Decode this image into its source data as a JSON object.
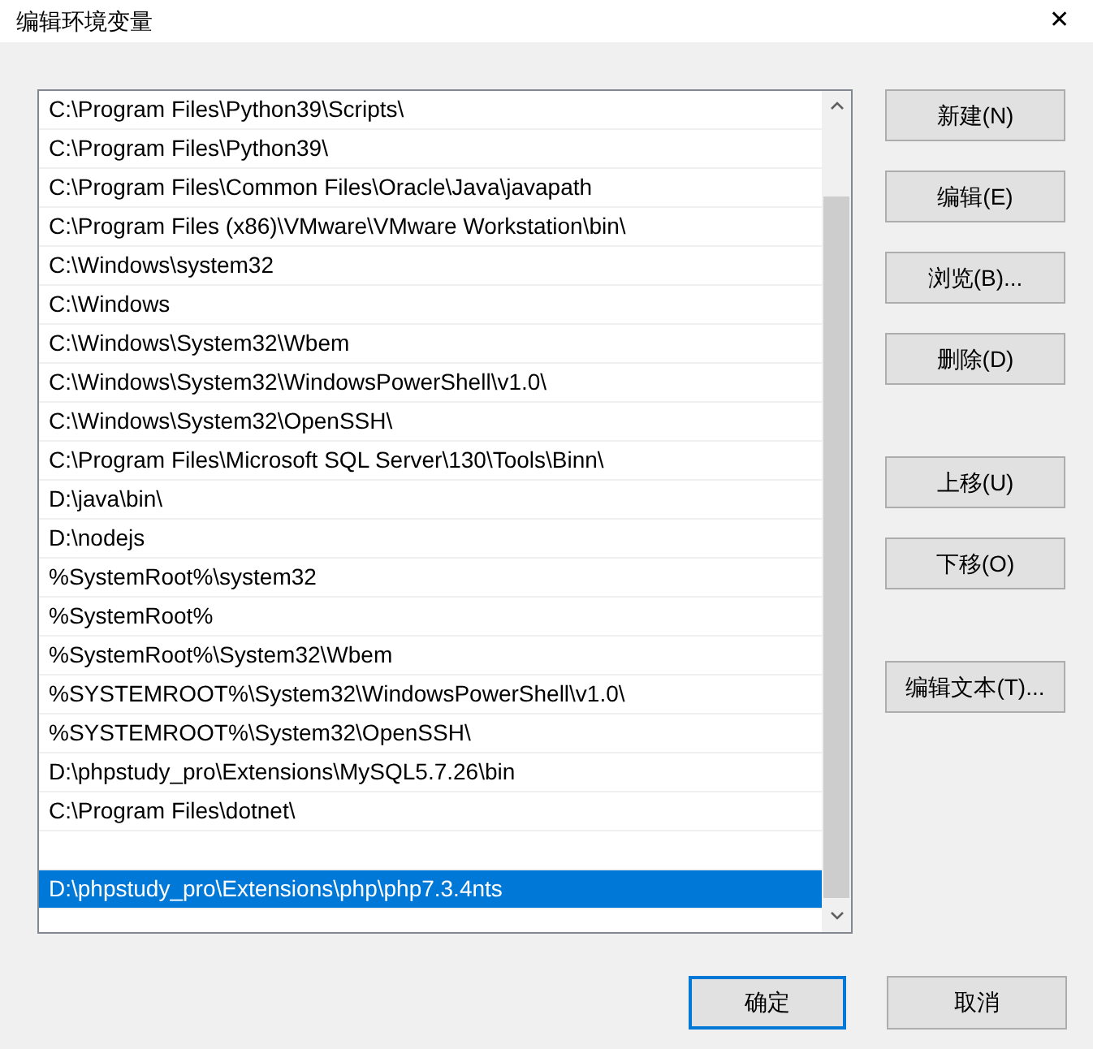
{
  "window": {
    "title": "编辑环境变量",
    "close": "✕"
  },
  "paths": [
    {
      "kind": "text",
      "label": "C:\\Program Files\\Python39\\Scripts\\",
      "selected": false
    },
    {
      "kind": "text",
      "label": "C:\\Program Files\\Python39\\",
      "selected": false
    },
    {
      "kind": "text",
      "label": "C:\\Program Files\\Common Files\\Oracle\\Java\\javapath",
      "selected": false
    },
    {
      "kind": "text",
      "label": "C:\\Program Files (x86)\\VMware\\VMware Workstation\\bin\\",
      "selected": false
    },
    {
      "kind": "text",
      "label": "C:\\Windows\\system32",
      "selected": false
    },
    {
      "kind": "text",
      "label": "C:\\Windows",
      "selected": false
    },
    {
      "kind": "text",
      "label": "C:\\Windows\\System32\\Wbem",
      "selected": false
    },
    {
      "kind": "text",
      "label": "C:\\Windows\\System32\\WindowsPowerShell\\v1.0\\",
      "selected": false
    },
    {
      "kind": "text",
      "label": "C:\\Windows\\System32\\OpenSSH\\",
      "selected": false
    },
    {
      "kind": "text",
      "label": "C:\\Program Files\\Microsoft SQL Server\\130\\Tools\\Binn\\",
      "selected": false
    },
    {
      "kind": "text",
      "label": "D:\\java\\bin\\",
      "selected": false
    },
    {
      "kind": "text",
      "label": "D:\\nodejs",
      "selected": false
    },
    {
      "kind": "text",
      "label": "%SystemRoot%\\system32",
      "selected": false
    },
    {
      "kind": "text",
      "label": "%SystemRoot%",
      "selected": false
    },
    {
      "kind": "text",
      "label": "%SystemRoot%\\System32\\Wbem",
      "selected": false
    },
    {
      "kind": "text",
      "label": "%SYSTEMROOT%\\System32\\WindowsPowerShell\\v1.0\\",
      "selected": false
    },
    {
      "kind": "text",
      "label": "%SYSTEMROOT%\\System32\\OpenSSH\\",
      "selected": false
    },
    {
      "kind": "text",
      "label": "D:\\phpstudy_pro\\Extensions\\MySQL5.7.26\\bin",
      "selected": false
    },
    {
      "kind": "text",
      "label": "C:\\Program Files\\dotnet\\",
      "selected": false
    },
    {
      "kind": "blank",
      "selected": false
    },
    {
      "kind": "text",
      "label": "D:\\phpstudy_pro\\Extensions\\php\\php7.3.4nts",
      "selected": true
    }
  ],
  "side_button_groups": [
    [
      "新建(N)",
      "编辑(E)",
      "浏览(B)...",
      "删除(D)"
    ],
    [
      "上移(U)",
      "下移(O)"
    ],
    [
      "编辑文本(T)..."
    ]
  ],
  "footer_buttons": [
    {
      "label": "确定",
      "default": true
    },
    {
      "label": "取消",
      "default": false
    }
  ]
}
